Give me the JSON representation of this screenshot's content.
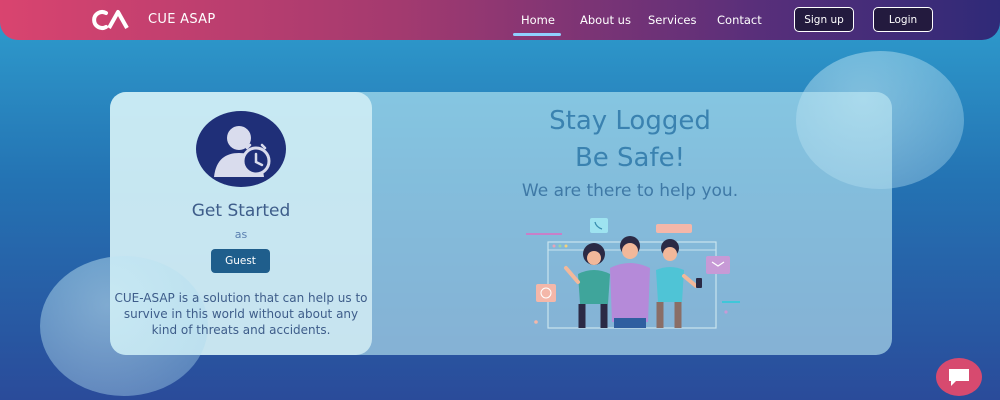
{
  "navbar": {
    "brand": "CUE ASAP",
    "links": [
      {
        "label": "Home"
      },
      {
        "label": "About us"
      },
      {
        "label": "Services"
      },
      {
        "label": "Contact"
      }
    ],
    "signup_label": "Sign up",
    "login_label": "Login"
  },
  "left_card": {
    "title": "Get Started",
    "as_label": "as",
    "guest_label": "Guest",
    "description": "CUE-ASAP is a solution that can help us to survive in this world without about any kind of threats and accidents."
  },
  "hero": {
    "line1": "Stay Logged",
    "line2": "Be Safe!",
    "subtitle": "We are there to help you."
  },
  "icons": {
    "logo": "ca-logo-icon",
    "avatar": "user-clock-icon",
    "chat": "chat-bubble-icon"
  },
  "colors": {
    "accent_pink": "#d9446f",
    "nav_dark": "#2f2a78",
    "guest_button": "#1f5e8c"
  }
}
